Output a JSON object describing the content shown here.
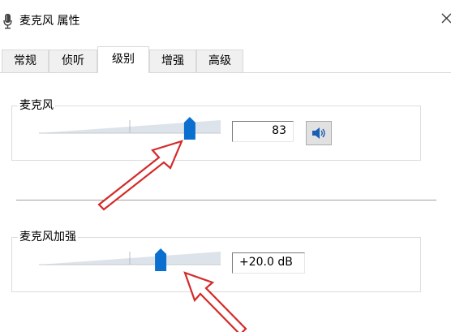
{
  "window": {
    "title": "麦克风 属性"
  },
  "tabs": [
    {
      "label": "常规",
      "active": false
    },
    {
      "label": "侦听",
      "active": false
    },
    {
      "label": "级别",
      "active": true
    },
    {
      "label": "增强",
      "active": false
    },
    {
      "label": "高级",
      "active": false
    }
  ],
  "microphone": {
    "label": "麦克风",
    "level_value": "83",
    "level_percent": 83,
    "mute_icon": "speaker-icon"
  },
  "boost": {
    "label": "麦克风加强",
    "value": "+20.0 dB",
    "level_fraction": 0.67
  },
  "colors": {
    "thumb": "#0a6fcf",
    "annotation_arrow": "#d42a2a"
  }
}
